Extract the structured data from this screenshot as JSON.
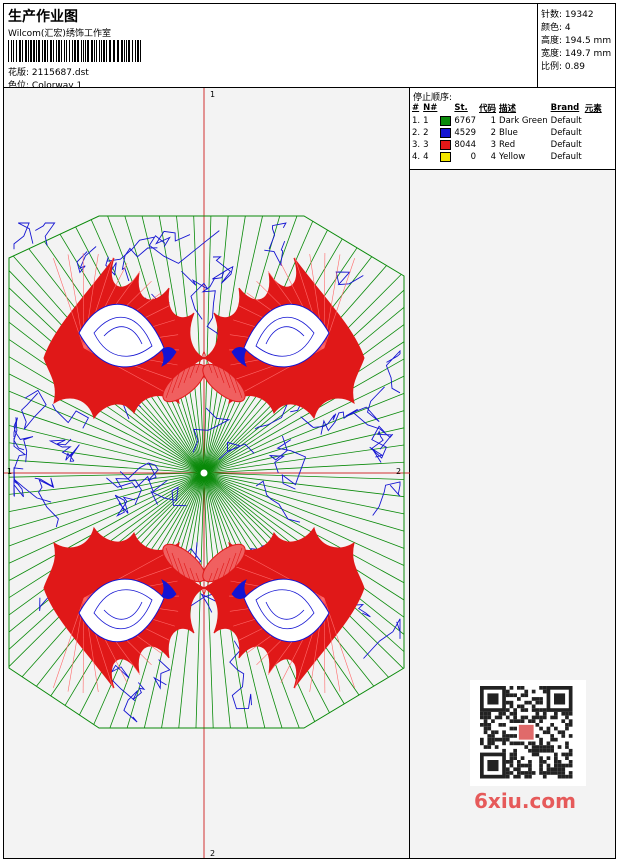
{
  "header": {
    "title": "生产作业图",
    "studio": "Wilcom(汇宏)绣饰工作室",
    "design_file_label": "花版:",
    "design_file_value": "2115687.dst",
    "colorway_label": "色位:",
    "colorway_value": "Colorway 1"
  },
  "stats": {
    "stitches_label": "针数:",
    "stitches_value": "19342",
    "colors_label": "颜色:",
    "colors_value": "4",
    "height_label": "高度:",
    "height_value": "194.5 mm",
    "width_label": "宽度:",
    "width_value": "149.7 mm",
    "scale_label": "比例:",
    "scale_value": "0.89"
  },
  "stop_sequence": {
    "title": "停止顺序:",
    "columns": {
      "index": "#",
      "number": "N#",
      "stitches": "St.",
      "code": "代码",
      "description": "描述",
      "brand": "Brand",
      "element": "元素"
    },
    "rows": [
      {
        "index": "1.",
        "number": "1",
        "color": "#0a8a0a",
        "stitches": "6767",
        "code": "1",
        "description": "Dark Green",
        "brand": "Default"
      },
      {
        "index": "2.",
        "number": "2",
        "color": "#1414d2",
        "stitches": "4529",
        "code": "2",
        "description": "Blue",
        "brand": "Default"
      },
      {
        "index": "3.",
        "number": "3",
        "color": "#e01818",
        "stitches": "8044",
        "code": "3",
        "description": "Red",
        "brand": "Default"
      },
      {
        "index": "4.",
        "number": "4",
        "color": "#f2e600",
        "stitches": "0",
        "code": "4",
        "description": "Yellow",
        "brand": "Default"
      }
    ]
  },
  "axes": {
    "v_top_label": "1",
    "v_bottom_label": "2",
    "h_left_label": "1",
    "h_right_label": "2"
  },
  "colors": {
    "green": "#0a8a0a",
    "blue": "#1414d2",
    "red": "#e01818",
    "axis": "#d03030"
  },
  "watermark": {
    "text": "6xiu.com",
    "color": "#e65a5a"
  }
}
